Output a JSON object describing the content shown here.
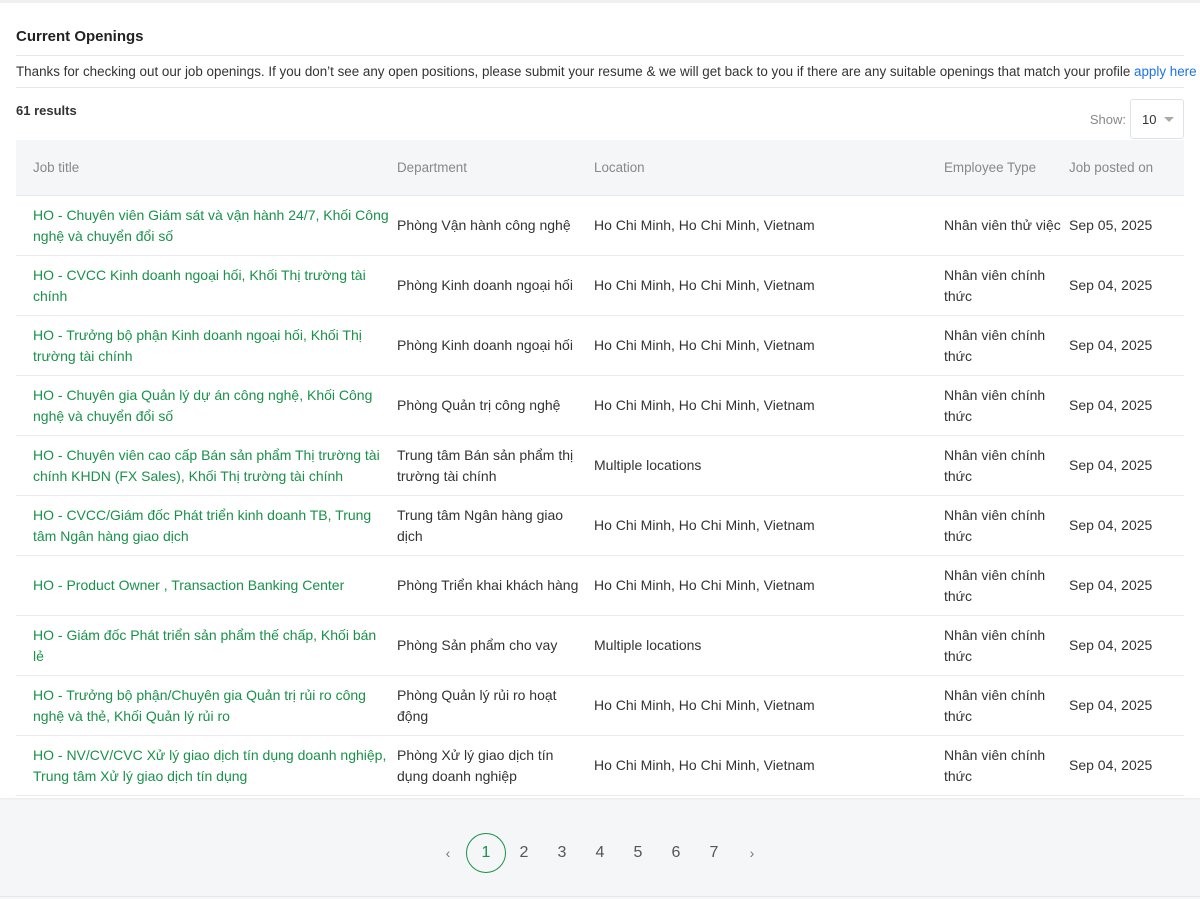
{
  "header": {
    "title": "Current Openings",
    "intro_text": "Thanks for checking out our job openings. If you don’t see any open positions, please submit your resume & we will get back to you if there are any suitable openings that match your profile ",
    "apply_link": "apply here"
  },
  "results": {
    "count_label": "61 results",
    "show_label": "Show:",
    "page_size": "10"
  },
  "table": {
    "headers": {
      "title": "Job title",
      "department": "Department",
      "location": "Location",
      "type": "Employee Type",
      "posted": "Job posted on"
    },
    "rows": [
      {
        "title": "HO - Chuyên viên Giám sát và vận hành 24/7, Khối Công nghệ và chuyển đổi số",
        "department": "Phòng Vận hành công nghệ",
        "location": "Ho Chi Minh, Ho Chi Minh, Vietnam",
        "type": "Nhân viên thử việc",
        "posted": "Sep 05, 2025"
      },
      {
        "title": "HO - CVCC Kinh doanh ngoại hối, Khối Thị trường tài chính",
        "department": "Phòng Kinh doanh ngoại hối",
        "location": "Ho Chi Minh, Ho Chi Minh, Vietnam",
        "type": "Nhân viên chính thức",
        "posted": "Sep 04, 2025"
      },
      {
        "title": "HO - Trưởng bộ phận Kinh doanh ngoại hối, Khối Thị trường tài chính",
        "department": "Phòng Kinh doanh ngoại hối",
        "location": "Ho Chi Minh, Ho Chi Minh, Vietnam",
        "type": "Nhân viên chính thức",
        "posted": "Sep 04, 2025"
      },
      {
        "title": "HO - Chuyên gia Quản lý dự án công nghệ, Khối Công nghệ và chuyển đổi số",
        "department": "Phòng Quản trị công nghệ",
        "location": "Ho Chi Minh, Ho Chi Minh, Vietnam",
        "type": "Nhân viên chính thức",
        "posted": "Sep 04, 2025"
      },
      {
        "title": "HO - Chuyên viên cao cấp Bán sản phẩm Thị trường tài chính KHDN (FX Sales), Khối Thị trường tài chính",
        "department": "Trung tâm Bán sản phẩm thị trường tài chính",
        "location": "Multiple locations",
        "type": "Nhân viên chính thức",
        "posted": "Sep 04, 2025"
      },
      {
        "title": "HO - CVCC/Giám đốc Phát triển kinh doanh TB, Trung tâm Ngân hàng giao dịch",
        "department": "Trung tâm Ngân hàng giao dịch",
        "location": "Ho Chi Minh, Ho Chi Minh, Vietnam",
        "type": "Nhân viên chính thức",
        "posted": "Sep 04, 2025"
      },
      {
        "title": "HO - Product Owner , Transaction Banking Center",
        "department": "Phòng Triển khai khách hàng",
        "location": "Ho Chi Minh, Ho Chi Minh, Vietnam",
        "type": "Nhân viên chính thức",
        "posted": "Sep 04, 2025"
      },
      {
        "title": "HO - Giám đốc Phát triển sản phẩm thế chấp, Khối bán lẻ",
        "department": "Phòng Sản phẩm cho vay",
        "location": "Multiple locations",
        "type": "Nhân viên chính thức",
        "posted": "Sep 04, 2025"
      },
      {
        "title": "HO - Trưởng bộ phận/Chuyên gia Quản trị rủi ro công nghệ và thẻ, Khối Quản lý rủi ro",
        "department": "Phòng Quản lý rủi ro hoạt động",
        "location": "Ho Chi Minh, Ho Chi Minh, Vietnam",
        "type": "Nhân viên chính thức",
        "posted": "Sep 04, 2025"
      },
      {
        "title": "HO - NV/CV/CVC Xử lý giao dịch tín dụng doanh nghiệp, Trung tâm Xử lý giao dịch tín dụng",
        "department": "Phòng Xử lý giao dịch tín dụng doanh nghiệp",
        "location": "Ho Chi Minh, Ho Chi Minh, Vietnam",
        "type": "Nhân viên chính thức",
        "posted": "Sep 04, 2025"
      }
    ]
  },
  "pagination": {
    "prev": "‹",
    "next": "›",
    "pages": [
      "1",
      "2",
      "3",
      "4",
      "5",
      "6",
      "7"
    ],
    "current": "1"
  },
  "colors": {
    "accent_green": "#19914a",
    "link_blue": "#1a73e8"
  }
}
